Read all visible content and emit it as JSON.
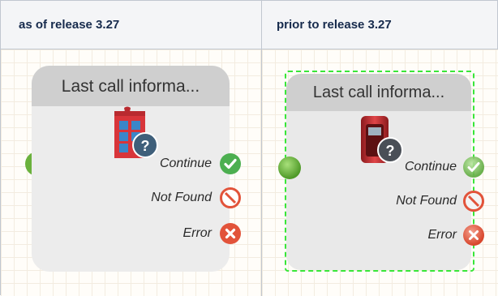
{
  "table": {
    "header_left": "as of release 3.27",
    "header_right": "prior to release 3.27"
  },
  "node_new": {
    "title": "Last call informa...",
    "ports": {
      "continue": "Continue",
      "not_found": "Not Found",
      "error": "Error"
    }
  },
  "node_old": {
    "title": "Last call informa...",
    "ports": {
      "continue": "Continue",
      "not_found": "Not Found",
      "error": "Error"
    }
  },
  "colors": {
    "continue": "#4caf50",
    "not_found": "#e2533a",
    "error": "#e2533a",
    "input_connector": "#6ab13c",
    "selection": "#39e639"
  },
  "icons": {
    "node": "phone-booth-question-icon",
    "continue": "checkmark-circle-icon",
    "not_found": "prohibited-icon",
    "error": "x-circle-icon"
  }
}
